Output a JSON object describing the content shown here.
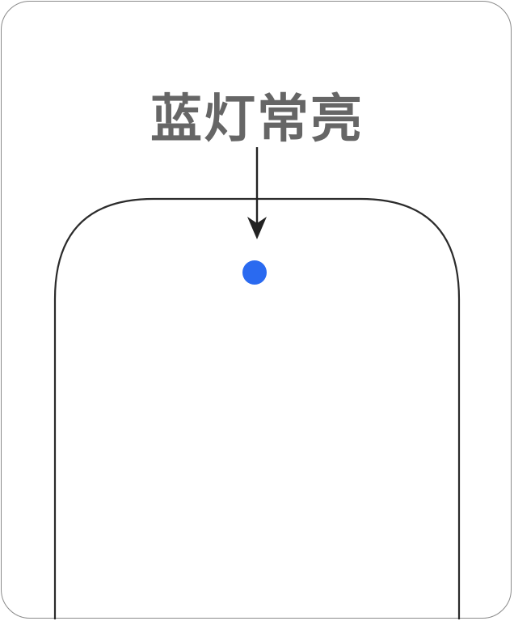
{
  "callout": {
    "label": "蓝灯常亮"
  },
  "indicator": {
    "state": "on",
    "color": "#2a6af0"
  },
  "colors": {
    "frame": "#8a8a8a",
    "device_outline": "#2b2b2b",
    "arrow": "#222222",
    "label": "#666666"
  },
  "icons": {
    "arrow": "arrow-down-icon",
    "indicator": "led-dot-icon"
  }
}
